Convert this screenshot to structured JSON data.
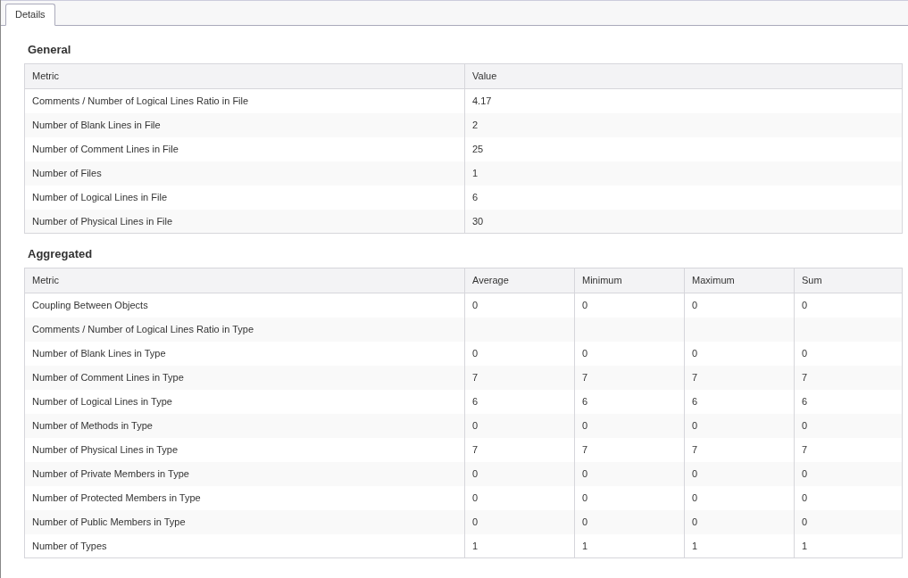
{
  "tabs": [
    {
      "label": "Details",
      "selected": true
    }
  ],
  "sections": [
    {
      "title": "General",
      "columns": [
        "Metric",
        "Value"
      ],
      "rows": [
        {
          "metric": "Comments / Number of Logical Lines Ratio in File",
          "values": [
            "4.17"
          ]
        },
        {
          "metric": "Number of Blank Lines in File",
          "values": [
            "2"
          ]
        },
        {
          "metric": "Number of Comment Lines in File",
          "values": [
            "25"
          ]
        },
        {
          "metric": "Number of Files",
          "values": [
            "1"
          ]
        },
        {
          "metric": "Number of Logical Lines in File",
          "values": [
            "6"
          ]
        },
        {
          "metric": "Number of Physical Lines in File",
          "values": [
            "30"
          ]
        }
      ]
    },
    {
      "title": "Aggregated",
      "columns": [
        "Metric",
        "Average",
        "Minimum",
        "Maximum",
        "Sum"
      ],
      "rows": [
        {
          "metric": "Coupling Between Objects",
          "values": [
            "0",
            "0",
            "0",
            "0"
          ]
        },
        {
          "metric": "Comments / Number of Logical Lines Ratio in Type"
        },
        {
          "metric": "Number of Blank Lines in Type",
          "values": [
            "0",
            "0",
            "0",
            "0"
          ]
        },
        {
          "metric": "Number of Comment Lines in Type",
          "values": [
            "7",
            "7",
            "7",
            "7"
          ]
        },
        {
          "metric": "Number of Logical Lines in Type",
          "values": [
            "6",
            "6",
            "6",
            "6"
          ]
        },
        {
          "metric": "Number of Methods in Type",
          "values": [
            "0",
            "0",
            "0",
            "0"
          ]
        },
        {
          "metric": "Number of Physical Lines in Type",
          "values": [
            "7",
            "7",
            "7",
            "7"
          ]
        },
        {
          "metric": "Number of Private Members in Type",
          "values": [
            "0",
            "0",
            "0",
            "0"
          ]
        },
        {
          "metric": "Number of Protected Members in Type",
          "values": [
            "0",
            "0",
            "0",
            "0"
          ]
        },
        {
          "metric": "Number of Public Members in Type",
          "values": [
            "0",
            "0",
            "0",
            "0"
          ]
        },
        {
          "metric": "Number of Types",
          "values": [
            "1",
            "1",
            "1",
            "1"
          ]
        }
      ]
    }
  ]
}
